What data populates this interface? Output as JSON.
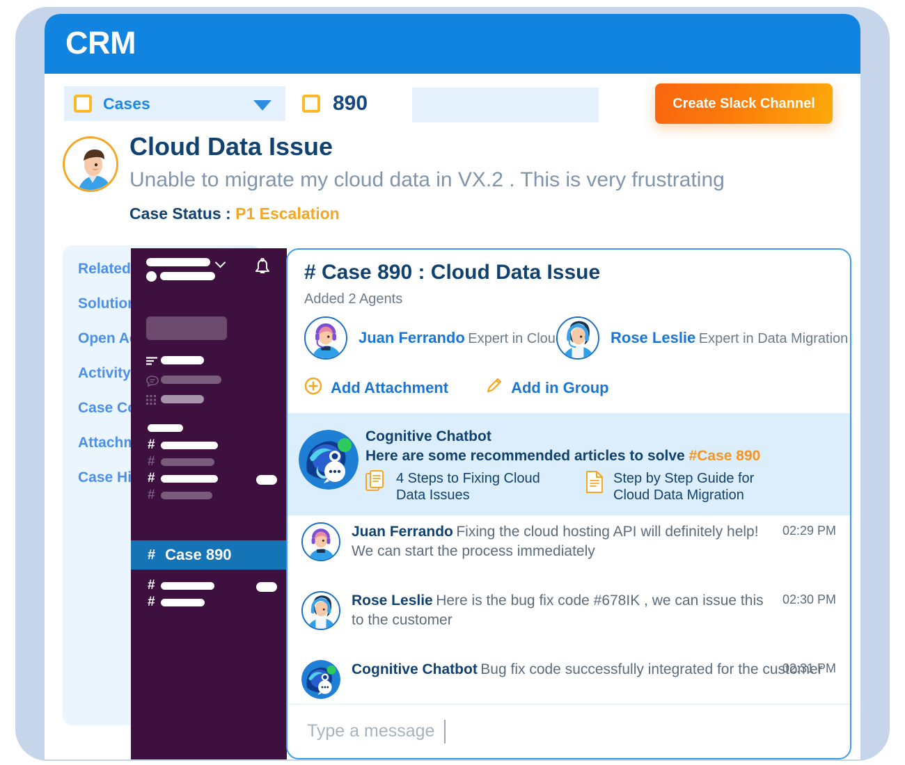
{
  "app": {
    "logo": "CRM",
    "header_color": "#1184e0"
  },
  "toolbar": {
    "select_label": "Cases",
    "select_icon": "square-outline-icon",
    "caret_icon": "chevron-down-icon",
    "record_number": "890",
    "record_icon": "square-outline-icon",
    "blank_field_value": "",
    "create_button": "Create Slack Channel",
    "button_gradient_from": "#f96610",
    "button_gradient_to": "#fcaa09"
  },
  "case": {
    "avatar": "customer-avatar",
    "title": "Cloud Data Issue",
    "subtitle": "Unable to migrate my cloud data in VX.2 . This is very frustrating",
    "status_label": "Case Status :",
    "status_value": "P1 Escalation",
    "status_color": "#f5a623"
  },
  "sidebar": {
    "items": [
      {
        "label": "Related Contacts"
      },
      {
        "label": "Solutions"
      },
      {
        "label": "Open Activities"
      },
      {
        "label": "Activity History"
      },
      {
        "label": "Case Comments"
      },
      {
        "label": "Attachments"
      },
      {
        "label": "Case History"
      }
    ]
  },
  "slack_panel": {
    "bell_icon": "bell-icon",
    "workspace_chevron_icon": "chevron-down-icon",
    "active_channel": {
      "hash": "#",
      "name": "Case 890"
    },
    "menu_icons": [
      "threads-lines-icon",
      "chat-bubble-icon",
      "apps-grid-icon"
    ]
  },
  "chat": {
    "title": "# Case 890 : Cloud Data Issue",
    "added_agents": "Added 2 Agents",
    "agents": [
      {
        "name": "Juan Ferrando",
        "role": "Expert in Cloud Data",
        "avatar": "agent-male-headset-avatar"
      },
      {
        "name": "Rose Leslie",
        "role": "Expert in Data Migration",
        "avatar": "agent-female-headset-avatar"
      }
    ],
    "actions": [
      {
        "label": "Add Attachment",
        "icon": "plus-circle-icon"
      },
      {
        "label": "Add in Group",
        "icon": "pencil-icon"
      }
    ],
    "bot_banner": {
      "bot_name": "Cognitive Chatbot",
      "bot_avatar": "cognitive-chatbot-avatar",
      "intro_text": "Here are some recommended articles to solve ",
      "highlight": "#Case 890",
      "articles": [
        {
          "title_line1": "4 Steps to Fixing Cloud",
          "title_line2": "Data Issues",
          "icon": "documents-icon"
        },
        {
          "title_line1": "Step by Step Guide for",
          "title_line2": "Cloud Data Migration",
          "icon": "document-icon"
        }
      ]
    },
    "messages": [
      {
        "author": "Juan Ferrando",
        "avatar": "agent-male-headset-avatar",
        "line1": "Fixing the cloud hosting API will definitely help!",
        "line2": "We can start the process immediately",
        "time": "02:29 PM"
      },
      {
        "author": "Rose Leslie",
        "avatar": "agent-female-headset-avatar",
        "line1": "Here is the bug fix code #678IK , we can issue this",
        "line2": "to the customer",
        "time": "02:30 PM"
      },
      {
        "author": "Cognitive Chatbot",
        "avatar": "cognitive-chatbot-avatar",
        "line1": "Bug fix code successfully integrated for the customer",
        "line2": "",
        "time": "02:31 PM"
      }
    ],
    "composer": {
      "placeholder": "Type a message"
    }
  }
}
